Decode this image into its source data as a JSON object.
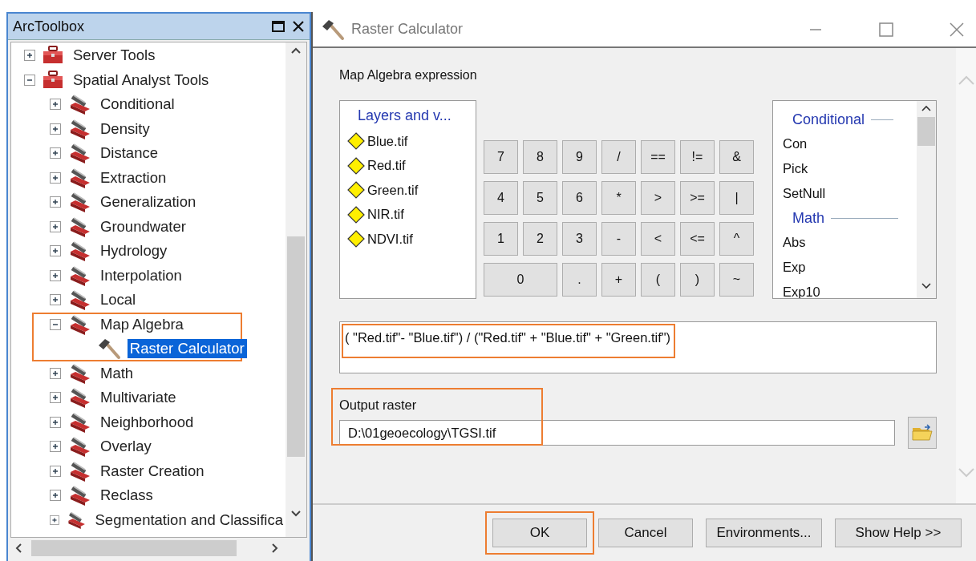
{
  "toolbox": {
    "title": "ArcToolbox",
    "tree": [
      {
        "label": "Server Tools",
        "kind": "toolbox",
        "expanded": false,
        "selected": false
      },
      {
        "label": "Spatial Analyst Tools",
        "kind": "toolbox",
        "expanded": true,
        "selected": false,
        "children": [
          {
            "label": "Conditional",
            "kind": "toolset",
            "expanded": false,
            "selected": false
          },
          {
            "label": "Density",
            "kind": "toolset",
            "expanded": false,
            "selected": false
          },
          {
            "label": "Distance",
            "kind": "toolset",
            "expanded": false,
            "selected": false
          },
          {
            "label": "Extraction",
            "kind": "toolset",
            "expanded": false,
            "selected": false
          },
          {
            "label": "Generalization",
            "kind": "toolset",
            "expanded": false,
            "selected": false
          },
          {
            "label": "Groundwater",
            "kind": "toolset",
            "expanded": false,
            "selected": false
          },
          {
            "label": "Hydrology",
            "kind": "toolset",
            "expanded": false,
            "selected": false
          },
          {
            "label": "Interpolation",
            "kind": "toolset",
            "expanded": false,
            "selected": false
          },
          {
            "label": "Local",
            "kind": "toolset",
            "expanded": false,
            "selected": false
          },
          {
            "label": "Map Algebra",
            "kind": "toolset",
            "expanded": true,
            "selected": false,
            "highlighted": true,
            "children": [
              {
                "label": "Raster Calculator",
                "kind": "tool",
                "selected": true
              }
            ]
          },
          {
            "label": "Math",
            "kind": "toolset",
            "expanded": false,
            "selected": false
          },
          {
            "label": "Multivariate",
            "kind": "toolset",
            "expanded": false,
            "selected": false
          },
          {
            "label": "Neighborhood",
            "kind": "toolset",
            "expanded": false,
            "selected": false
          },
          {
            "label": "Overlay",
            "kind": "toolset",
            "expanded": false,
            "selected": false
          },
          {
            "label": "Raster Creation",
            "kind": "toolset",
            "expanded": false,
            "selected": false
          },
          {
            "label": "Reclass",
            "kind": "toolset",
            "expanded": false,
            "selected": false
          },
          {
            "label": "Segmentation and Classifica",
            "kind": "toolset",
            "expanded": false,
            "selected": false
          }
        ]
      }
    ]
  },
  "dialog": {
    "title": "Raster Calculator",
    "expression_label": "Map Algebra expression",
    "layers": {
      "heading": "Layers and v...",
      "items": [
        "Blue.tif",
        "Red.tif",
        "Green.tif",
        "NIR.tif",
        "NDVI.tif"
      ]
    },
    "keypad": [
      [
        {
          "label": "7",
          "kind": "normal"
        },
        {
          "label": "8",
          "kind": "normal"
        },
        {
          "label": "9",
          "kind": "normal"
        },
        {
          "label": "/",
          "kind": "normal"
        },
        {
          "label": "==",
          "kind": "normal"
        },
        {
          "label": "!=",
          "kind": "normal"
        },
        {
          "label": "&",
          "kind": "normal"
        }
      ],
      [
        {
          "label": "4",
          "kind": "normal"
        },
        {
          "label": "5",
          "kind": "normal"
        },
        {
          "label": "6",
          "kind": "normal"
        },
        {
          "label": "*",
          "kind": "normal"
        },
        {
          "label": ">",
          "kind": "normal"
        },
        {
          "label": ">=",
          "kind": "normal"
        },
        {
          "label": "|",
          "kind": "normal"
        }
      ],
      [
        {
          "label": "1",
          "kind": "normal"
        },
        {
          "label": "2",
          "kind": "normal"
        },
        {
          "label": "3",
          "kind": "normal"
        },
        {
          "label": "-",
          "kind": "normal"
        },
        {
          "label": "<",
          "kind": "normal"
        },
        {
          "label": "<=",
          "kind": "normal"
        },
        {
          "label": "^",
          "kind": "normal"
        }
      ],
      [
        {
          "label": "0",
          "kind": "wide"
        },
        {
          "label": ".",
          "kind": "normal"
        },
        {
          "label": "+",
          "kind": "normal"
        },
        {
          "label": "(",
          "kind": "normal"
        },
        {
          "label": ")",
          "kind": "normal"
        },
        {
          "label": "~",
          "kind": "normal"
        }
      ]
    ],
    "functions": [
      {
        "heading": "Conditional",
        "items": [
          "Con",
          "Pick",
          "SetNull"
        ]
      },
      {
        "heading": "Math",
        "items": [
          "Abs",
          "Exp",
          "Exp10"
        ]
      }
    ],
    "expression": {
      "value": "( \"Red.tif\"- \"Blue.tif\") / (\"Red.tif\" + \"Blue.tif\" + \"Green.tif\")",
      "highlighted": true
    },
    "output": {
      "label": "Output raster",
      "value": "D:\\01geoecology\\TGSI.tif",
      "highlighted": true
    },
    "buttons": [
      {
        "label": "OK",
        "highlighted": true
      },
      {
        "label": "Cancel",
        "highlighted": false
      },
      {
        "label": "Environments...",
        "highlighted": false
      },
      {
        "label": "Show Help >>",
        "highlighted": false
      }
    ]
  }
}
